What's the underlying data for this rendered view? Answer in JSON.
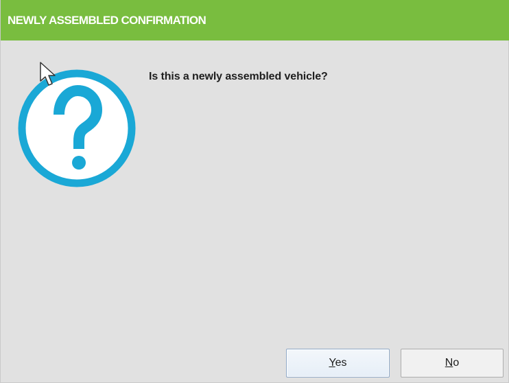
{
  "window": {
    "title": "NEWLY ASSEMBLED CONFIRMATION"
  },
  "dialog": {
    "icon": "question-icon",
    "message": "Is this a newly assembled vehicle?"
  },
  "buttons": {
    "yes_label": "Yes",
    "no_label": "No"
  },
  "colors": {
    "titlebar": "#79bd3f",
    "icon_accent": "#1aa8d6",
    "background": "#e1e1e1"
  }
}
